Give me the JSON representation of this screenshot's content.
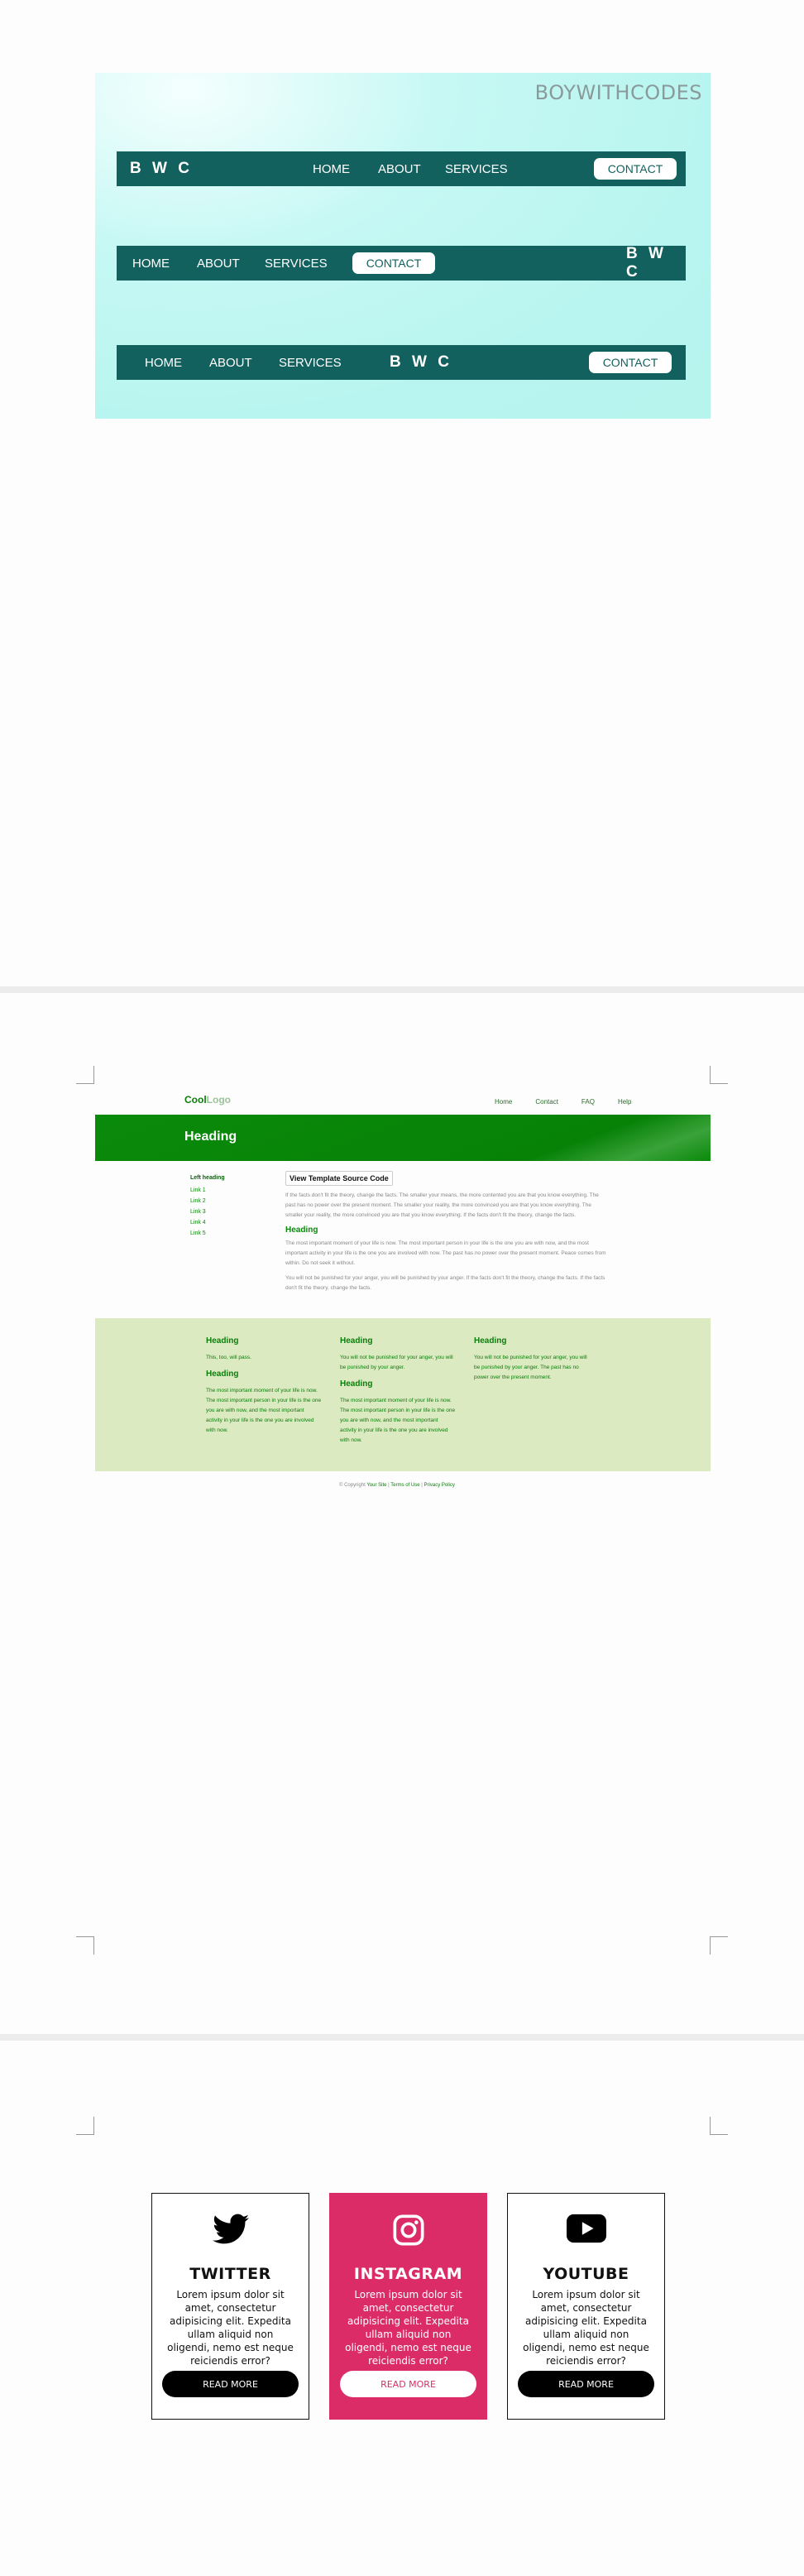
{
  "page1": {
    "watermark": "BOYWITHCODES",
    "navbars": [
      {
        "logo": "B W C",
        "links": [
          "HOME",
          "ABOUT",
          "SERVICES"
        ],
        "cta": "CONTACT"
      },
      {
        "logo": "B W C",
        "links": [
          "HOME",
          "ABOUT",
          "SERVICES"
        ],
        "cta": "CONTACT"
      },
      {
        "logo": "B W C",
        "links": [
          "HOME",
          "ABOUT",
          "SERVICES"
        ],
        "cta": "CONTACT"
      }
    ]
  },
  "page2": {
    "logo_a": "Cool",
    "logo_b": "Logo",
    "top_links": [
      "Home",
      "Contact",
      "FAQ",
      "Help"
    ],
    "band_heading": "Heading",
    "left_heading": "Left heading",
    "left_links": [
      "Link 1",
      "Link 2",
      "Link 3",
      "Link 4",
      "Link 5"
    ],
    "view_source": "View Template Source Code",
    "para1": "If the facts don't fit the theory, change the facts. The smaller your means, the more contented you are that you know everything. The past has no power over the present moment. The smaller your reality, the more convinced you are that you know everything. The smaller your reality, the more convinced you are that you know everything. If the facts don't fit the theory, change the facts.",
    "heading2": "Heading",
    "para2": "The most important moment of your life is now. The most important person in your life is the one you are with now, and the most important activity in your life is the one you are involved with now. The past has no power over the present moment. Peace comes from within. Do not seek it without.",
    "para3": "You will not be punished for your anger, you will be punished by your anger. If the facts don't fit the theory, change the facts. If the facts don't fit the theory, change the facts.",
    "footer_cols": [
      {
        "h1": "Heading",
        "p1": "This, too, will pass.",
        "h2": "Heading",
        "p2": "The most important moment of your life is now. The most important person in your life is the one you are with now, and the most important activity in your life is the one you are involved with now."
      },
      {
        "h1": "Heading",
        "p1": "You will not be punished for your anger, you will be punished by your anger.",
        "h2": "Heading",
        "p2": "The most important moment of your life is now. The most important person in your life is the one you are with now, and the most important activity in your life is the one you are involved with now."
      },
      {
        "h1": "Heading",
        "p1": "You will not be punished for your anger, you will be punished by your anger. The past has no power over the present moment."
      }
    ],
    "copyright_prefix": "© Copyright",
    "copyright_links": [
      "Your Site",
      "Terms of Use",
      "Privacy Policy"
    ]
  },
  "page3": {
    "cards": [
      {
        "icon": "twitter-icon",
        "name": "TWITTER",
        "desc": "Lorem ipsum dolor sit amet, consectetur adipisicing elit. Expedita ullam aliquid non oligendi, nemo est neque reiciendis error?",
        "button": "READ MORE"
      },
      {
        "icon": "instagram-icon",
        "name": "INSTAGRAM",
        "desc": "Lorem ipsum dolor sit amet, consectetur adipisicing elit. Expedita ullam aliquid non oligendi, nemo est neque reiciendis error?",
        "button": "READ MORE"
      },
      {
        "icon": "youtube-icon",
        "name": "YOUTUBE",
        "desc": "Lorem ipsum dolor sit amet, consectetur adipisicing elit. Expedita ullam aliquid non oligendi, nemo est neque reiciendis error?",
        "button": "READ MORE"
      }
    ]
  },
  "colors": {
    "teal_nav": "#13615e",
    "cyan_panel": "#b9f5f0",
    "green_band": "#0a8a0a",
    "light_green": "#dbeac1",
    "instagram_pink": "#db2c68"
  }
}
